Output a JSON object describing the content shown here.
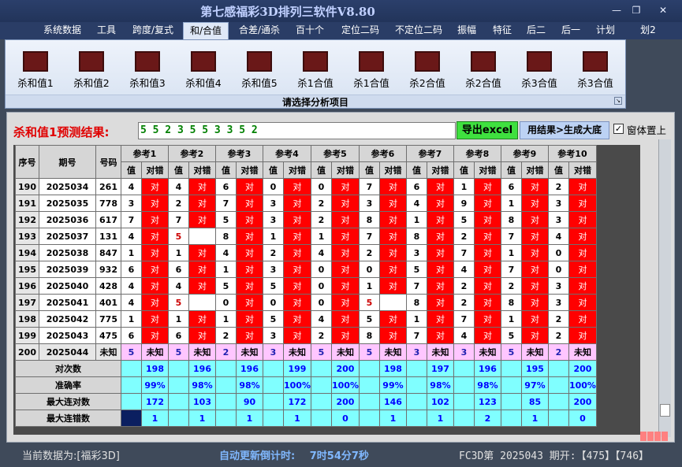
{
  "window": {
    "title": "第七感福彩3D排列三软件V8.80",
    "controls": [
      "—",
      "❐",
      "✕"
    ]
  },
  "menu": {
    "items": [
      "系统数据",
      "工具",
      "跨度/复式",
      "和/合值",
      "合差/通杀",
      "百十个",
      "定位二码",
      "不定位二码",
      "振幅",
      "特征",
      "后二",
      "后一",
      "计划",
      "划2"
    ],
    "active_index": 3
  },
  "ribbon": {
    "buttons": [
      "杀和值1",
      "杀和值2",
      "杀和值3",
      "杀和值4",
      "杀和值5",
      "杀1合值",
      "杀1合值",
      "杀2合值",
      "杀2合值",
      "杀3合值",
      "杀3合值"
    ],
    "caption": "请选择分析项目"
  },
  "prediction": {
    "label": "杀和值1预测结果:",
    "value": "5 5 2 3 5 5 3 3 5 2",
    "export_button": "导出excel",
    "generate_button": "用结果>生成大底",
    "checkbox_label": "窗体置上",
    "checkbox_checked": true
  },
  "table": {
    "headers": {
      "idx": "序号",
      "period": "期号",
      "code": "号码",
      "refs": [
        "参考1",
        "参考2",
        "参考3",
        "参考4",
        "参考5",
        "参考6",
        "参考7",
        "参考8",
        "参考9",
        "参考10"
      ],
      "val": "值",
      "check": "对错"
    },
    "rows": [
      {
        "idx": "190",
        "period": "2025034",
        "code": "261",
        "vals": [
          "4",
          "4",
          "6",
          "0",
          "0",
          "7",
          "6",
          "1",
          "6",
          "2"
        ],
        "hits": [
          "对",
          "对",
          "对",
          "对",
          "对",
          "对",
          "对",
          "对",
          "对",
          "对"
        ]
      },
      {
        "idx": "191",
        "period": "2025035",
        "code": "778",
        "vals": [
          "3",
          "2",
          "7",
          "3",
          "2",
          "3",
          "4",
          "9",
          "1",
          "3"
        ],
        "hits": [
          "对",
          "对",
          "对",
          "对",
          "对",
          "对",
          "对",
          "对",
          "对",
          "对"
        ]
      },
      {
        "idx": "192",
        "period": "2025036",
        "code": "617",
        "vals": [
          "7",
          "7",
          "5",
          "3",
          "2",
          "8",
          "1",
          "5",
          "8",
          "3"
        ],
        "hits": [
          "对",
          "对",
          "对",
          "对",
          "对",
          "对",
          "对",
          "对",
          "对",
          "对"
        ]
      },
      {
        "idx": "193",
        "period": "2025037",
        "code": "131",
        "vals": [
          "4",
          "5",
          "8",
          "1",
          "1",
          "7",
          "8",
          "2",
          "7",
          "4"
        ],
        "hits": [
          "对",
          "",
          "对",
          "对",
          "对",
          "对",
          "对",
          "对",
          "对",
          "对"
        ]
      },
      {
        "idx": "194",
        "period": "2025038",
        "code": "847",
        "vals": [
          "1",
          "1",
          "4",
          "2",
          "4",
          "2",
          "3",
          "7",
          "1",
          "0"
        ],
        "hits": [
          "对",
          "对",
          "对",
          "对",
          "对",
          "对",
          "对",
          "对",
          "对",
          "对"
        ]
      },
      {
        "idx": "195",
        "period": "2025039",
        "code": "932",
        "vals": [
          "6",
          "6",
          "1",
          "3",
          "0",
          "0",
          "5",
          "4",
          "7",
          "0"
        ],
        "hits": [
          "对",
          "对",
          "对",
          "对",
          "对",
          "对",
          "对",
          "对",
          "对",
          "对"
        ]
      },
      {
        "idx": "196",
        "period": "2025040",
        "code": "428",
        "vals": [
          "4",
          "4",
          "5",
          "5",
          "0",
          "1",
          "7",
          "2",
          "2",
          "3"
        ],
        "hits": [
          "对",
          "对",
          "对",
          "对",
          "对",
          "对",
          "对",
          "对",
          "对",
          "对"
        ]
      },
      {
        "idx": "197",
        "period": "2025041",
        "code": "401",
        "vals": [
          "4",
          "5",
          "0",
          "0",
          "0",
          "5",
          "8",
          "2",
          "8",
          "3"
        ],
        "hits": [
          "对",
          "",
          "对",
          "对",
          "对",
          "",
          "对",
          "对",
          "对",
          "对"
        ]
      },
      {
        "idx": "198",
        "period": "2025042",
        "code": "775",
        "vals": [
          "1",
          "1",
          "1",
          "5",
          "4",
          "5",
          "1",
          "7",
          "1",
          "2"
        ],
        "hits": [
          "对",
          "对",
          "对",
          "对",
          "对",
          "对",
          "对",
          "对",
          "对",
          "对"
        ]
      },
      {
        "idx": "199",
        "period": "2025043",
        "code": "475",
        "vals": [
          "6",
          "6",
          "2",
          "3",
          "2",
          "8",
          "7",
          "4",
          "5",
          "2"
        ],
        "hits": [
          "对",
          "对",
          "对",
          "对",
          "对",
          "对",
          "对",
          "对",
          "对",
          "对"
        ]
      }
    ],
    "unknown_row": {
      "idx": "200",
      "period": "2025044",
      "code": "未知",
      "vals": [
        "5",
        "5",
        "2",
        "3",
        "5",
        "5",
        "3",
        "3",
        "5",
        "2"
      ],
      "hit": "未知"
    },
    "stats": [
      {
        "label": "对次数",
        "values": [
          "198",
          "196",
          "196",
          "199",
          "200",
          "198",
          "197",
          "196",
          "195",
          "200"
        ]
      },
      {
        "label": "准确率",
        "values": [
          "99%",
          "98%",
          "98%",
          "100%",
          "100%",
          "99%",
          "98%",
          "98%",
          "97%",
          "100%"
        ]
      },
      {
        "label": "最大连对数",
        "values": [
          "172",
          "103",
          "90",
          "172",
          "200",
          "146",
          "102",
          "123",
          "85",
          "200"
        ]
      },
      {
        "label": "最大连错数",
        "values": [
          "1",
          "1",
          "1",
          "1",
          "0",
          "1",
          "1",
          "2",
          "1",
          "0"
        ]
      }
    ]
  },
  "status": {
    "current_data": "当前数据为:[福彩3D]",
    "countdown_label": "自动更新倒计时:",
    "countdown_value": "7时54分7秒",
    "issue_info": "FC3D第 2025043 期开:【475】【746】"
  }
}
